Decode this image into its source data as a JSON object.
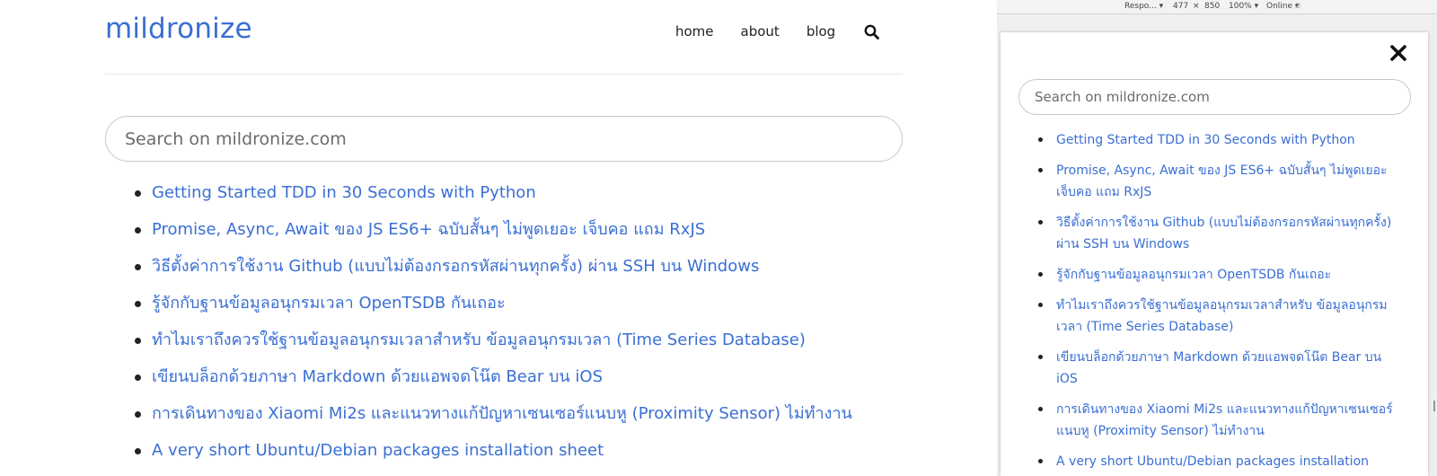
{
  "desktop": {
    "site_title": "mildronize",
    "nav": [
      {
        "label": "home"
      },
      {
        "label": "about"
      },
      {
        "label": "blog"
      }
    ],
    "search_placeholder": "Search on mildronize.com",
    "results": [
      "Getting Started TDD in 30 Seconds with Python",
      "Promise, Async, Await ของ JS ES6+ ฉบับสั้นๆ ไม่พูดเยอะ เจ็บคอ แถม RxJS",
      "วิธีตั้งค่าการใช้งาน Github (แบบไม่ต้องกรอกรหัสผ่านทุกครั้ง) ผ่าน SSH บน Windows",
      "รู้จักกับฐานข้อมูลอนุกรมเวลา OpenTSDB กันเถอะ",
      "ทำไมเราถึงควรใช้ฐานข้อมูลอนุกรมเวลาสำหรับ ข้อมูลอนุกรมเวลา (Time Series Database)",
      "เขียนบล็อกด้วยภาษา Markdown ด้วยแอพจดโน๊ต Bear บน iOS",
      "การเดินทางของ Xiaomi Mi2s และแนวทางแก้ปัญหาเซนเซอร์แนบหู (Proximity Sensor) ไม่ทำงาน",
      "A very short Ubuntu/Debian packages installation sheet"
    ]
  },
  "devtools": {
    "device": "Respo...",
    "width": "477",
    "times": "×",
    "height": "850",
    "zoom": "100%",
    "network": "Online",
    "mobile": {
      "search_placeholder": "Search on mildronize.com",
      "results": [
        "Getting Started TDD in 30 Seconds with Python",
        "Promise, Async, Await ของ JS ES6+ ฉบับสั้นๆ ไม่พูดเยอะ เจ็บคอ แถม RxJS",
        "วิธีตั้งค่าการใช้งาน Github (แบบไม่ต้องกรอกรหัสผ่านทุกครั้ง) ผ่าน SSH บน Windows",
        "รู้จักกับฐานข้อมูลอนุกรมเวลา OpenTSDB กันเถอะ",
        "ทำไมเราถึงควรใช้ฐานข้อมูลอนุกรมเวลาสำหรับ ข้อมูลอนุกรมเวลา (Time Series Database)",
        "เขียนบล็อกด้วยภาษา Markdown ด้วยแอพจดโน๊ต Bear บน iOS",
        "การเดินทางของ Xiaomi Mi2s และแนวทางแก้ปัญหาเซนเซอร์แนบหู (Proximity Sensor) ไม่ทำงาน",
        "A very short Ubuntu/Debian packages installation"
      ]
    }
  },
  "colors": {
    "accent": "#3a6fd3",
    "text": "#222222",
    "border": "#c9c9c9"
  },
  "icons": [
    "search-icon",
    "close-icon"
  ]
}
